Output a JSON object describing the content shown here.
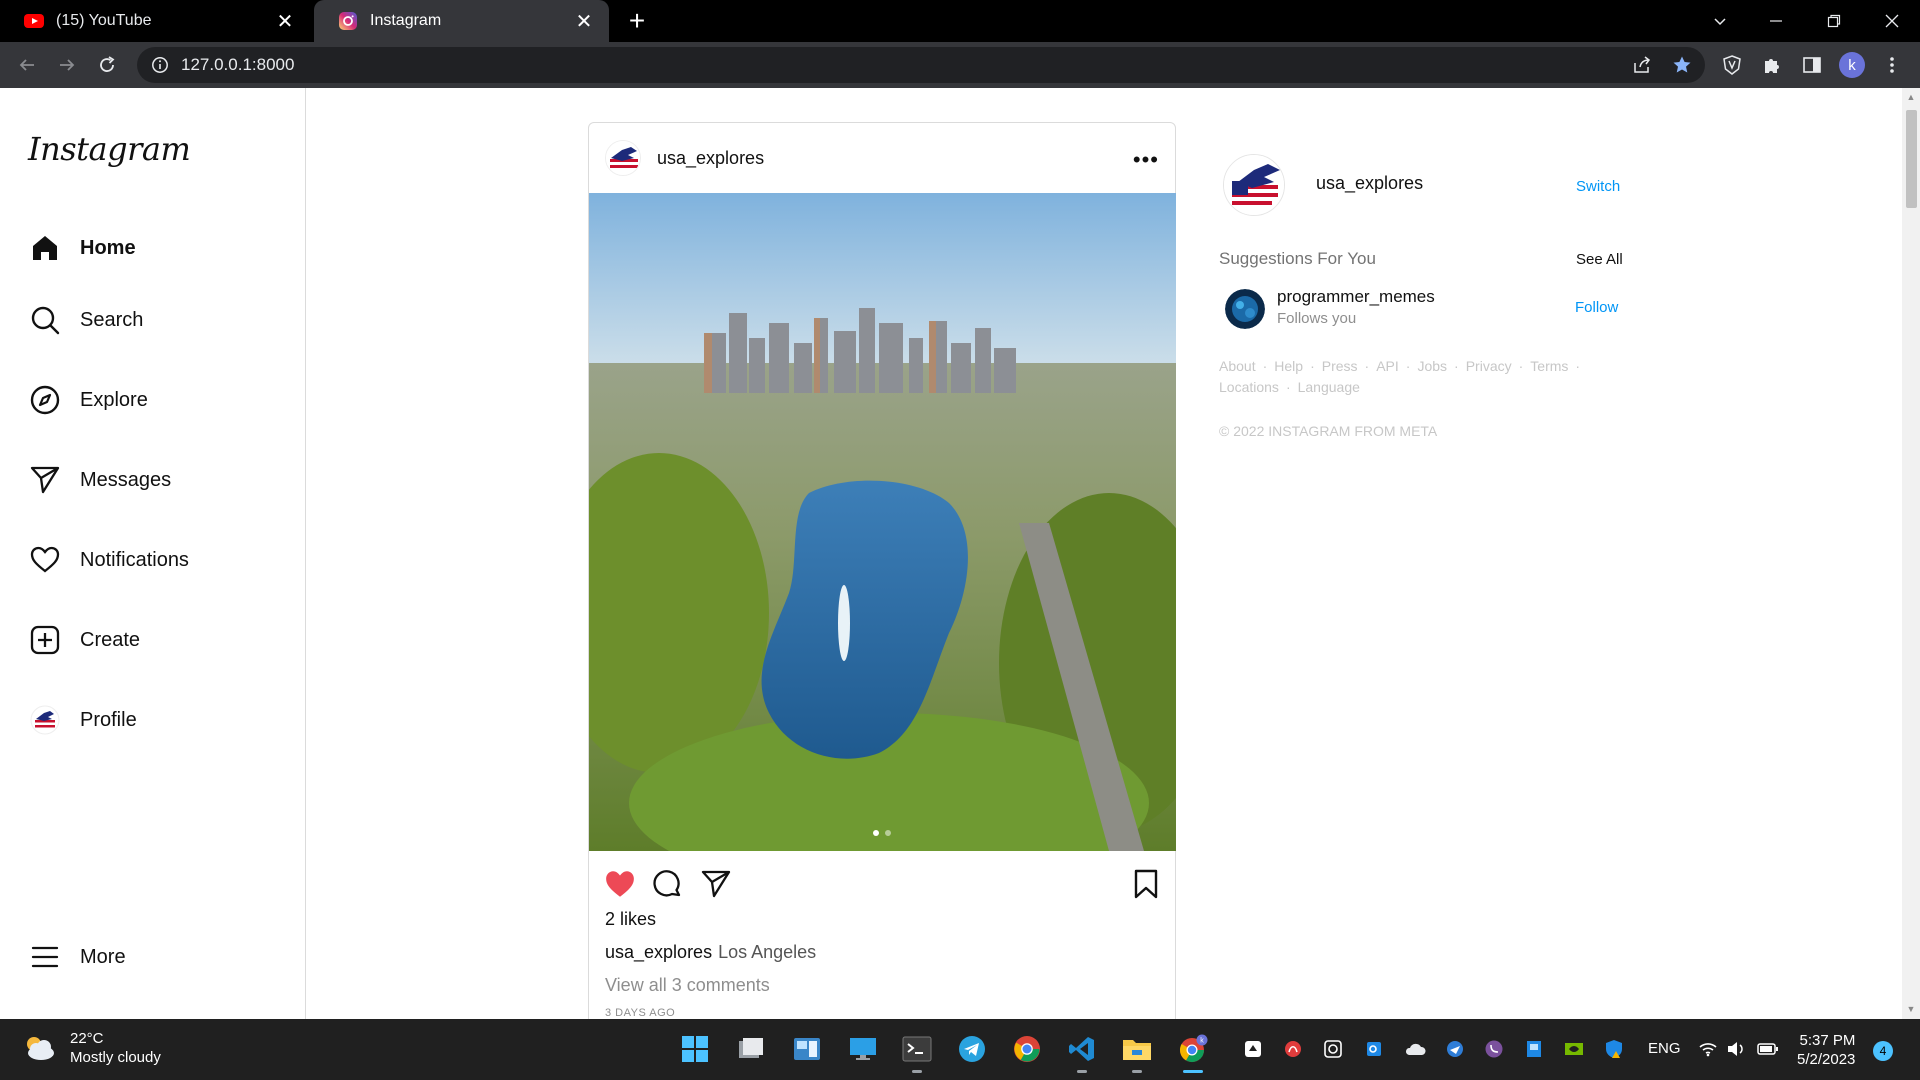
{
  "browser": {
    "tabs": [
      {
        "title": "(15) YouTube",
        "icon": "youtube-icon",
        "active": false
      },
      {
        "title": "Instagram",
        "icon": "instagram-icon",
        "active": true
      }
    ],
    "url": "127.0.0.1:8000"
  },
  "sidebar": {
    "logo": "Instagram",
    "items": [
      {
        "label": "Home",
        "icon": "home-icon",
        "active": true
      },
      {
        "label": "Search",
        "icon": "search-icon"
      },
      {
        "label": "Explore",
        "icon": "compass-icon"
      },
      {
        "label": "Messages",
        "icon": "send-icon"
      },
      {
        "label": "Notifications",
        "icon": "heart-icon"
      },
      {
        "label": "Create",
        "icon": "plus-square-icon"
      },
      {
        "label": "Profile",
        "icon": "profile-avatar-icon"
      }
    ],
    "more_label": "More"
  },
  "post": {
    "username": "usa_explores",
    "image_alt_icon": "city-lake-photo",
    "likes": "2 likes",
    "caption_user": "usa_explores",
    "caption_text": "Los Angeles",
    "view_comments": "View all 3 comments",
    "time_ago": "3 DAYS AGO",
    "liked": true
  },
  "right_panel": {
    "username": "usa_explores",
    "switch_label": "Switch",
    "suggestions_title": "Suggestions For You",
    "see_all": "See All",
    "suggestions": [
      {
        "username": "programmer_memes",
        "subtitle": "Follows you",
        "action": "Follow"
      }
    ],
    "footer_links": [
      "About",
      "Help",
      "Press",
      "API",
      "Jobs",
      "Privacy",
      "Terms",
      "Locations",
      "Language"
    ],
    "copyright": "© 2022 INSTAGRAM FROM META"
  },
  "taskbar": {
    "weather_temp": "22°C",
    "weather_desc": "Mostly cloudy",
    "language": "ENG",
    "time": "5:37 PM",
    "date": "5/2/2023",
    "notification_count": "4"
  },
  "colors": {
    "accent_blue": "#0095f6",
    "like_red": "#ed4956",
    "chrome_dark": "#35363a"
  }
}
